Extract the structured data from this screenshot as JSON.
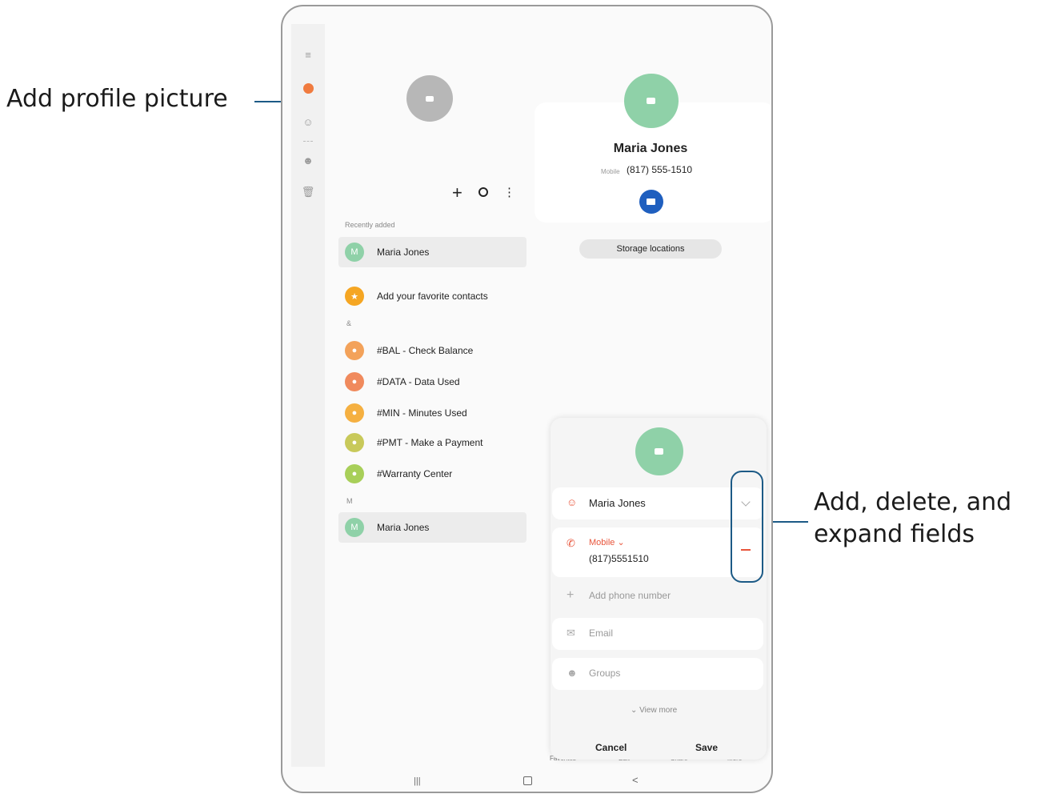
{
  "callouts": {
    "profile_picture": "Add profile picture",
    "fields_line1": "Add, delete, and",
    "fields_line2": "expand fields"
  },
  "toolbar": {
    "add": "+",
    "search": "⚲",
    "more": "⋮"
  },
  "contacts": {
    "recently_added_label": "Recently added",
    "recent": [
      {
        "initial": "M",
        "name": "Maria Jones"
      }
    ],
    "favorites_prompt": "Add your favorite contacts",
    "amp_section": "&",
    "amp_items": [
      {
        "name": "#BAL - Check Balance",
        "color": "#f3a25a"
      },
      {
        "name": "#DATA - Data Used",
        "color": "#f08a5d"
      },
      {
        "name": "#MIN - Minutes Used",
        "color": "#f5b041"
      },
      {
        "name": "#PMT - Make a Payment",
        "color": "#c8c95a"
      },
      {
        "name": "#Warranty Center",
        "color": "#a8cf59"
      }
    ],
    "m_section": "M",
    "m_items": [
      {
        "initial": "M",
        "name": "Maria Jones"
      }
    ]
  },
  "detail": {
    "name": "Maria Jones",
    "phone_label": "Mobile",
    "phone": "(817) 555-1510",
    "storage_button": "Storage locations"
  },
  "edit_form": {
    "name_value": "Maria Jones",
    "phone_type": "Mobile",
    "phone_value": "(817)5551510",
    "add_phone": "Add phone number",
    "email": "Email",
    "groups": "Groups",
    "view_more": "View more",
    "cancel": "Cancel",
    "save": "Save"
  },
  "bottom_tabs": [
    "Favorites",
    "Edit",
    "Share",
    "More"
  ],
  "nav": {
    "recents": "|||",
    "home": "◻",
    "back": "<"
  },
  "colors": {
    "accent_green": "#8fd1a8",
    "video_blue": "#1f5fbf",
    "callout_line": "#1c5a86",
    "delete_red": "#e8553b"
  }
}
